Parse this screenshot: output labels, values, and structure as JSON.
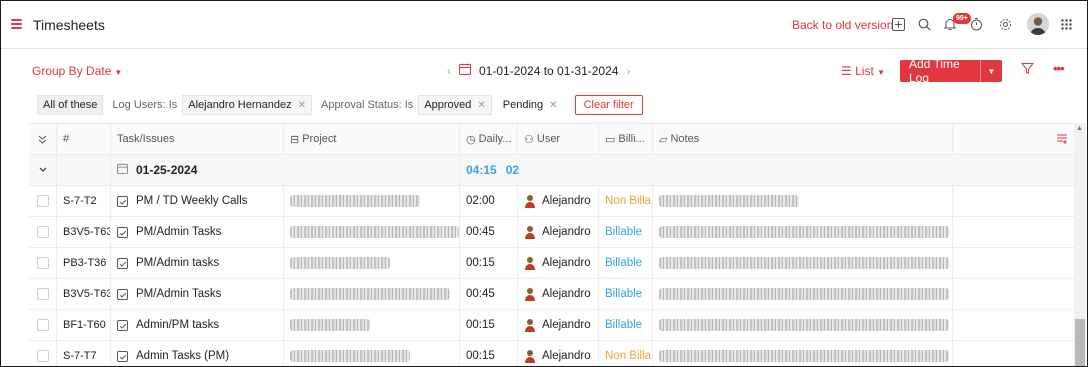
{
  "topbar": {
    "title": "Timesheets",
    "back_link": "Back to old version",
    "badge": "99+",
    "icons": [
      "add-square-icon",
      "search-icon",
      "notification-bell-icon",
      "timer-icon",
      "settings-icon",
      "apps-grid-icon"
    ]
  },
  "toolbar": {
    "group_by": "Group By Date",
    "date_range": "01-01-2024 to 01-31-2024",
    "view_mode": "List",
    "add_button": "Add Time Log"
  },
  "filters": {
    "scope": "All of these",
    "users_label": "Log Users: Is",
    "users_value": "Alejandro Hernandez",
    "approval_label": "Approval Status: Is",
    "approval_values": [
      "Approved",
      "Pending"
    ],
    "clear": "Clear filter"
  },
  "table": {
    "headers": {
      "num": "#",
      "task": "Task/Issues",
      "project": "Project",
      "daily": "Daily...",
      "user": "User",
      "billing": "Billi...",
      "notes": "Notes"
    },
    "group": {
      "date": "01-25-2024",
      "total": "04:15",
      "extra": "02"
    },
    "rows": [
      {
        "id": "S-7-T2",
        "task": "PM / TD Weekly Calls",
        "hours": "02:00",
        "user": "Alejandro",
        "billing": "Non Billa",
        "billable": false
      },
      {
        "id": "B3V5-T63",
        "task": "PM/Admin Tasks",
        "hours": "00:45",
        "user": "Alejandro",
        "billing": "Billable",
        "billable": true
      },
      {
        "id": "PB3-T36",
        "task": "PM/Admin tasks",
        "hours": "00:15",
        "user": "Alejandro",
        "billing": "Billable",
        "billable": true
      },
      {
        "id": "B3V5-T63",
        "task": "PM/Admin Tasks",
        "hours": "00:45",
        "user": "Alejandro",
        "billing": "Billable",
        "billable": true
      },
      {
        "id": "BF1-T60",
        "task": "Admin/PM tasks",
        "hours": "00:15",
        "user": "Alejandro",
        "billing": "Billable",
        "billable": true
      },
      {
        "id": "S-7-T7",
        "task": "Admin Tasks (PM)",
        "hours": "00:15",
        "user": "Alejandro",
        "billing": "Non Billa",
        "billable": false
      }
    ]
  },
  "colors": {
    "accent": "#e0383e",
    "billable": "#35a6dd",
    "non_billable": "#f2a23a",
    "group_time": "#35a6dd"
  }
}
